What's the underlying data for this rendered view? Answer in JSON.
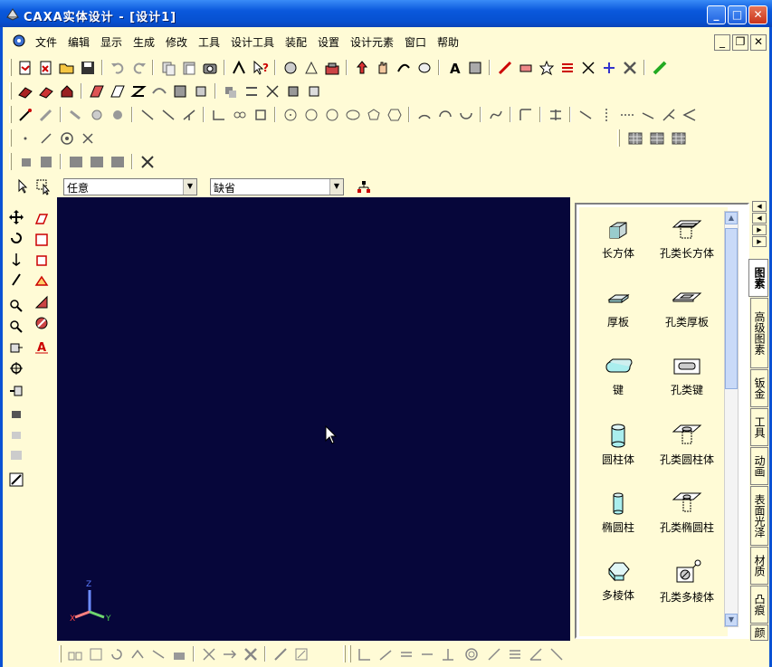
{
  "window": {
    "title": "CAXA实体设计 - [设计1]"
  },
  "menu": [
    "文件",
    "编辑",
    "显示",
    "生成",
    "修改",
    "工具",
    "设计工具",
    "装配",
    "设置",
    "设计元素",
    "窗口",
    "帮助"
  ],
  "filters": {
    "select_filter": "任意",
    "snap_mode": "缺省"
  },
  "panel": {
    "items": [
      {
        "label": "长方体",
        "icon": "box-icon"
      },
      {
        "label": "孔类长方体",
        "icon": "hole-box-icon"
      },
      {
        "label": "厚板",
        "icon": "thick-plate-icon"
      },
      {
        "label": "孔类厚板",
        "icon": "hole-plate-icon"
      },
      {
        "label": "键",
        "icon": "key-icon"
      },
      {
        "label": "孔类键",
        "icon": "hole-key-icon"
      },
      {
        "label": "圆柱体",
        "icon": "cylinder-icon"
      },
      {
        "label": "孔类圆柱体",
        "icon": "hole-cylinder-icon"
      },
      {
        "label": "椭圆柱",
        "icon": "elliptic-cylinder-icon"
      },
      {
        "label": "孔类椭圆柱",
        "icon": "hole-elliptic-cylinder-icon"
      },
      {
        "label": "多棱体",
        "icon": "prism-icon"
      },
      {
        "label": "孔类多棱体",
        "icon": "hole-prism-icon"
      }
    ]
  },
  "tabs": [
    "图素",
    "高级图素",
    "钣金",
    "工具",
    "动画",
    "表面光泽",
    "材质",
    "凸痕",
    "颜"
  ],
  "axis": {
    "x": "X",
    "y": "Y",
    "z": "Z"
  },
  "colors": {
    "canvas": "#06063a",
    "titlebar": "#0a58dc",
    "toolbar_bg": "#fffbd6"
  }
}
